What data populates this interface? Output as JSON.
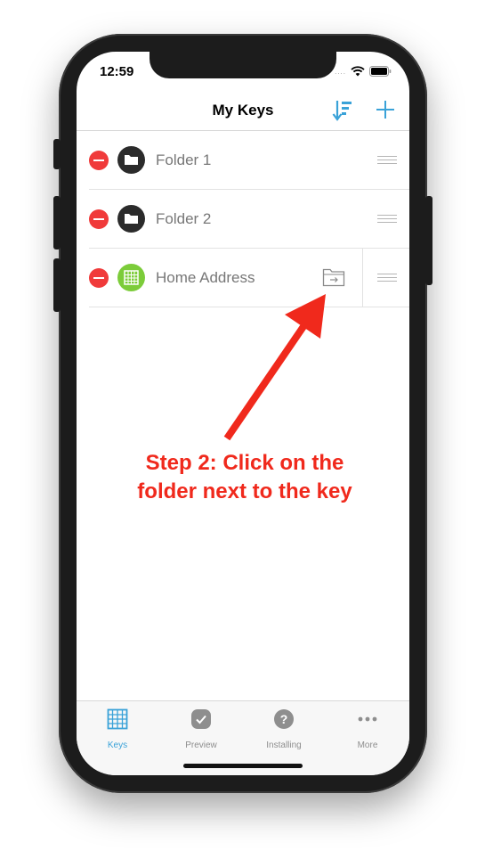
{
  "status_bar": {
    "time": "12:59",
    "signal": "....",
    "wifi_icon": "wifi-icon",
    "battery_icon": "battery-icon"
  },
  "nav": {
    "title": "My Keys",
    "sort_icon": "sort-icon",
    "add_icon": "plus-icon"
  },
  "rows": [
    {
      "label": "Folder 1",
      "icon": "folder-icon",
      "icon_bg": "#2b2b2b"
    },
    {
      "label": "Folder 2",
      "icon": "folder-icon",
      "icon_bg": "#2b2b2b"
    },
    {
      "label": "Home Address",
      "icon": "keyboard-icon",
      "icon_bg": "#7ccc3a",
      "action_icon": "move-to-folder-icon"
    }
  ],
  "annotation": {
    "line1": "Step 2: Click on the",
    "line2": "folder next to the key",
    "color": "#f0291c"
  },
  "tabbar": {
    "tabs": [
      {
        "label": "Keys",
        "icon": "keyboard-icon",
        "active": true
      },
      {
        "label": "Preview",
        "icon": "checkmark-icon",
        "active": false
      },
      {
        "label": "Installing",
        "icon": "question-icon",
        "active": false
      },
      {
        "label": "More",
        "icon": "more-dots-icon",
        "active": false
      }
    ]
  },
  "colors": {
    "accent": "#3aa2d8",
    "delete": "#f03a3a"
  }
}
